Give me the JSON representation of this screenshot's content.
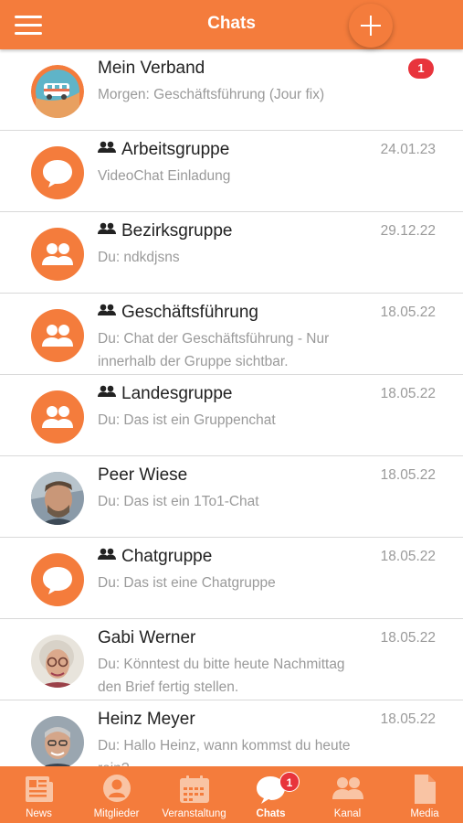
{
  "header": {
    "title": "Chats"
  },
  "chats": [
    {
      "name": "Mein Verband",
      "subtitle": "Morgen: Geschäftsführung (Jour fix)",
      "badge": "1",
      "group": false,
      "avatar": "photo-logo"
    },
    {
      "name": "Arbeitsgruppe",
      "subtitle": "VideoChat Einladung",
      "date": "24.01.23",
      "group": true,
      "avatar": "chat-bubble-icon"
    },
    {
      "name": "Bezirksgruppe",
      "subtitle": "Du: ndkdjsns",
      "date": "29.12.22",
      "group": true,
      "avatar": "group-icon"
    },
    {
      "name": "Geschäftsführung",
      "subtitle": "Du: Chat der Geschäftsführung - Nur innerhalb der Gruppe sichtbar.",
      "date": "18.05.22",
      "group": true,
      "avatar": "group-icon"
    },
    {
      "name": "Landesgruppe",
      "subtitle": "Du: Das ist ein Gruppenchat",
      "date": "18.05.22",
      "group": true,
      "avatar": "group-icon"
    },
    {
      "name": "Peer Wiese",
      "subtitle": "Du: Das ist ein 1To1-Chat",
      "date": "18.05.22",
      "group": false,
      "avatar": "photo"
    },
    {
      "name": "Chatgruppe",
      "subtitle": "Du: Das ist eine Chatgruppe",
      "date": "18.05.22",
      "group": true,
      "avatar": "chat-bubble-icon"
    },
    {
      "name": "Gabi Werner",
      "subtitle": "Du: Könntest du bitte heute Nachmittag den Brief fertig stellen.",
      "date": "18.05.22",
      "group": false,
      "avatar": "photo"
    },
    {
      "name": "Heinz Meyer",
      "subtitle": "Du: Hallo Heinz, wann kommst du heute rein?",
      "date": "18.05.22",
      "group": false,
      "avatar": "photo"
    }
  ],
  "tabs": [
    {
      "label": "News",
      "icon": "news-icon"
    },
    {
      "label": "Mitglieder",
      "icon": "person-icon"
    },
    {
      "label": "Veranstaltung",
      "icon": "calendar-icon"
    },
    {
      "label": "Chats",
      "icon": "chat-icon",
      "badge": "1",
      "active": true
    },
    {
      "label": "Kanal",
      "icon": "group-icon"
    },
    {
      "label": "Media",
      "icon": "document-icon"
    }
  ],
  "colors": {
    "accent": "#f47c3c",
    "badge": "#e8343c",
    "subtitle": "#9a9a9a"
  }
}
